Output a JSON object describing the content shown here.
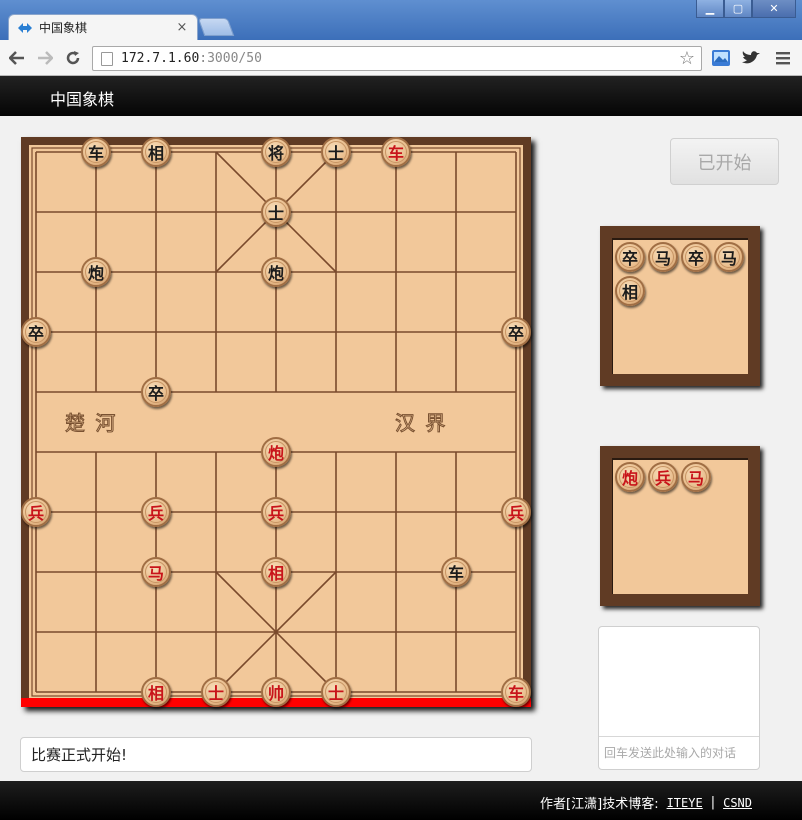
{
  "browser": {
    "tab_title": "中国象棋",
    "tab_close": "×",
    "url_host": "172.7.1.60",
    "url_path": ":3000/50",
    "win_min": "▁",
    "win_max": "▢",
    "win_close": "✕",
    "icons": [
      "back-arrow-icon",
      "forward-arrow-icon",
      "reload-icon",
      "bookmark-star-icon",
      "photo-extension-icon",
      "twitter-bird-icon",
      "menu-icon"
    ]
  },
  "header": {
    "brand": "中国象棋"
  },
  "board": {
    "river_left": "楚  河",
    "river_right": "汉  界",
    "pieces": [
      {
        "label": "车",
        "side": "black",
        "col": 1,
        "row": 0
      },
      {
        "label": "相",
        "side": "black",
        "col": 2,
        "row": 0
      },
      {
        "label": "将",
        "side": "black",
        "col": 4,
        "row": 0
      },
      {
        "label": "士",
        "side": "black",
        "col": 5,
        "row": 0
      },
      {
        "label": "车",
        "side": "red",
        "col": 6,
        "row": 0
      },
      {
        "label": "士",
        "side": "black",
        "col": 4,
        "row": 1
      },
      {
        "label": "炮",
        "side": "black",
        "col": 1,
        "row": 2
      },
      {
        "label": "炮",
        "side": "black",
        "col": 4,
        "row": 2
      },
      {
        "label": "卒",
        "side": "black",
        "col": 0,
        "row": 3
      },
      {
        "label": "卒",
        "side": "black",
        "col": 8,
        "row": 3
      },
      {
        "label": "卒",
        "side": "black",
        "col": 2,
        "row": 4
      },
      {
        "label": "炮",
        "side": "red",
        "col": 4,
        "row": 5
      },
      {
        "label": "兵",
        "side": "red",
        "col": 0,
        "row": 6
      },
      {
        "label": "兵",
        "side": "red",
        "col": 2,
        "row": 6
      },
      {
        "label": "兵",
        "side": "red",
        "col": 4,
        "row": 6
      },
      {
        "label": "兵",
        "side": "red",
        "col": 8,
        "row": 6
      },
      {
        "label": "马",
        "side": "red",
        "col": 2,
        "row": 7
      },
      {
        "label": "相",
        "side": "red",
        "col": 4,
        "row": 7
      },
      {
        "label": "车",
        "side": "black",
        "col": 7,
        "row": 7
      },
      {
        "label": "相",
        "side": "red",
        "col": 2,
        "row": 9
      },
      {
        "label": "士",
        "side": "red",
        "col": 3,
        "row": 9
      },
      {
        "label": "帅",
        "side": "red",
        "col": 4,
        "row": 9
      },
      {
        "label": "士",
        "side": "red",
        "col": 5,
        "row": 9
      },
      {
        "label": "车",
        "side": "red",
        "col": 8,
        "row": 9
      }
    ]
  },
  "start_button": "已开始",
  "captured_top": [
    {
      "label": "卒",
      "side": "black"
    },
    {
      "label": "马",
      "side": "black"
    },
    {
      "label": "卒",
      "side": "black"
    },
    {
      "label": "马",
      "side": "black"
    },
    {
      "label": "相",
      "side": "black"
    }
  ],
  "captured_bottom": [
    {
      "label": "炮",
      "side": "red"
    },
    {
      "label": "兵",
      "side": "red"
    },
    {
      "label": "马",
      "side": "red"
    }
  ],
  "chat": {
    "placeholder": "回车发送此处输入的对话"
  },
  "status": "比赛正式开始!",
  "footer": {
    "author": "作者[江潇]技术博客:",
    "link1": "ITEYE",
    "separator": "|",
    "link2": "CSND"
  }
}
